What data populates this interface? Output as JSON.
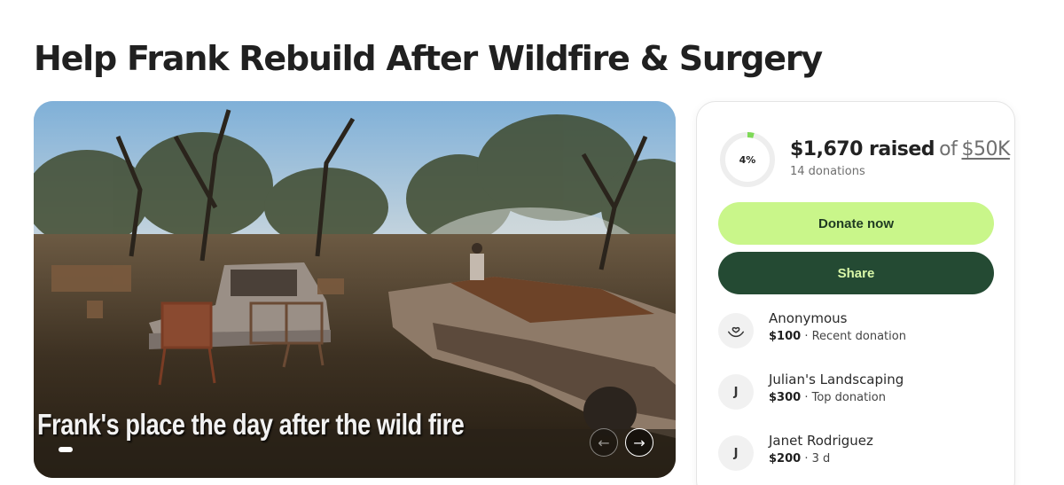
{
  "page": {
    "title": "Help Frank Rebuild After Wildfire & Surgery"
  },
  "hero": {
    "caption": "Frank's place the day after the wild fire",
    "prev_icon": "arrow-left-icon",
    "next_icon": "arrow-right-icon",
    "prev_glyph": "←",
    "next_glyph": "→",
    "slide_index": 1
  },
  "fundraiser": {
    "progress_fraction": 0.04,
    "progress_label": "4%",
    "raised": "$1,670 raised",
    "of_text": "of",
    "goal": "$50K",
    "donation_count": "14 donations",
    "donate_label": "Donate now",
    "share_label": "Share",
    "accent_color": "#c9f68a",
    "share_color": "#244a33",
    "progress_color": "#7ed957"
  },
  "donations": [
    {
      "initial": "",
      "icon": "donation-heart-hand-icon",
      "name": "Anonymous",
      "amount": "$100",
      "meta": " · Recent donation"
    },
    {
      "initial": "J",
      "icon": "",
      "name": "Julian's Landscaping",
      "amount": "$300",
      "meta": " · Top donation"
    },
    {
      "initial": "J",
      "icon": "",
      "name": "Janet Rodriguez",
      "amount": "$200",
      "meta": " · 3 d"
    }
  ]
}
